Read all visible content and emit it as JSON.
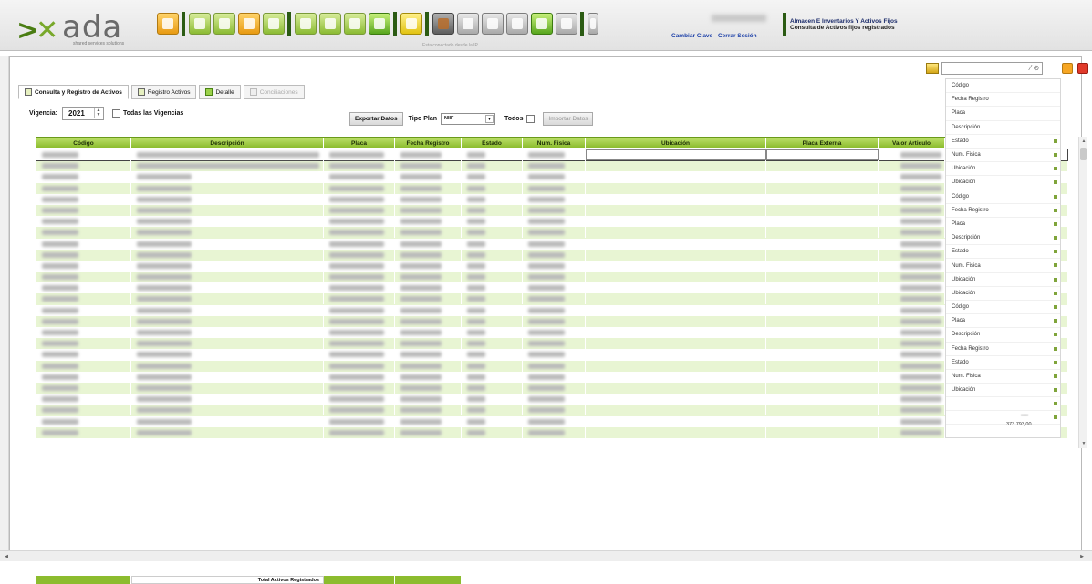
{
  "app": {
    "logo_text": "ada",
    "tagline": "shared services solutions",
    "connected_text": "Esta conectado desde la IP"
  },
  "session": {
    "change_password": "Cambiar Clave",
    "logout": "Cerrar Sesión"
  },
  "module": {
    "title": "Almacen E Inventarios Y Activos Fijos",
    "subtitle": "Consulta de Activos fijos registrados"
  },
  "toolbar_icons": [
    "folder-icon",
    "document-icon",
    "chart-icon",
    "edit-icon",
    "window-icon",
    "list-icon",
    "search-icon",
    "image-icon",
    "monitor-icon",
    "lock-icon",
    "record-icon",
    "calculator-icon",
    "grid-icon",
    "table-icon",
    "check-icon",
    "tools-icon",
    "palette-icon"
  ],
  "tabs": [
    {
      "label": "Consulta y Registro de Activos",
      "state": "active"
    },
    {
      "label": "Registro Activos",
      "state": "normal"
    },
    {
      "label": "Detalle",
      "state": "normal"
    },
    {
      "label": "Conciliaciones",
      "state": "disabled"
    }
  ],
  "filters": {
    "vigencia_label": "Vigencia:",
    "vigencia_value": "2021",
    "todas_vigencias": "Todas las Vigencias",
    "exportar": "Exportar Datos",
    "tipo_plan_label": "Tipo Plan",
    "tipo_plan_value": "NIIF",
    "todos_label": "Todos",
    "importar": "Importar Datos"
  },
  "grid": {
    "columns": [
      "Código",
      "Descripción",
      "Placa",
      "Fecha Registro",
      "Estado",
      "Num. Fisica",
      "Ubicación",
      "Placa Externa",
      "Valor Articulo"
    ],
    "row_count": 26,
    "footer_label": "Total Activos Registrados"
  },
  "column_menu": [
    "Código",
    "Fecha Registro",
    "Placa",
    "Descripción",
    "Estado",
    "Num. Fisica",
    "Ubicación",
    "Ubicación",
    "Código",
    "Fecha Registro",
    "Placa",
    "Descripción",
    "Estado",
    "Num. Fisica",
    "Ubicación",
    "Ubicación",
    "Código",
    "Placa",
    "Descripción",
    "Fecha Registro",
    "Estado",
    "Num. Fisica",
    "Ubicación"
  ],
  "total_value": "373.793,00",
  "colors": {
    "accent_green": "#8cbc2e",
    "row_alt": "#e8f5d3",
    "link_blue": "#1b3fa8"
  }
}
